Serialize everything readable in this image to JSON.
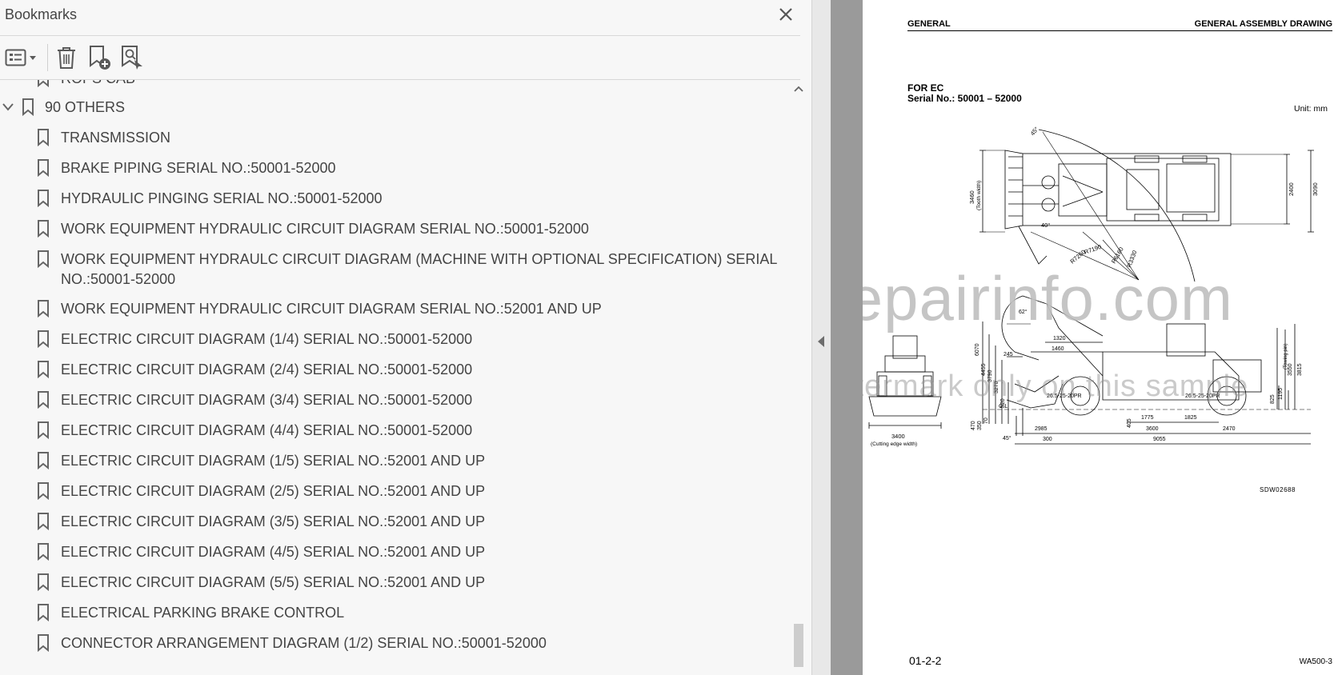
{
  "panel": {
    "title": "Bookmarks",
    "close_label": "✕",
    "toolbar": {
      "options_icon": "list-options-icon",
      "delete_icon": "trash-icon",
      "add_icon": "add-bookmark-icon",
      "find_icon": "find-bookmark-icon"
    },
    "items": [
      {
        "label": "ROPS CAB",
        "level": 1
      },
      {
        "label": "90 OTHERS",
        "level": 0,
        "expanded": true
      },
      {
        "label": "TRANSMISSION",
        "level": 1
      },
      {
        "label": "BRAKE PIPING SERIAL NO.:50001-52000",
        "level": 1
      },
      {
        "label": "HYDRAULIC PINGING SERIAL NO.:50001-52000",
        "level": 1
      },
      {
        "label": "WORK EQUIPMENT HYDRAULIC CIRCUIT DIAGRAM SERIAL NO.:50001-52000",
        "level": 1
      },
      {
        "label": "WORK EQUIPMENT HYDRAULC CIRCUIT DIAGRAM (MACHINE WITH OPTIONAL SPECIFICATION) SERIAL",
        "label2": "NO.:50001-52000",
        "level": 1
      },
      {
        "label": "WORK EQUIPMENT HYDRAULIC CIRCUIT DIAGRAM SERIAL NO.:52001 AND UP",
        "level": 1
      },
      {
        "label": "ELECTRIC CIRCUIT DIAGRAM (1/4) SERIAL NO.:50001-52000",
        "level": 1
      },
      {
        "label": "ELECTRIC CIRCUIT DIAGRAM (2/4) SERIAL NO.:50001-52000",
        "level": 1
      },
      {
        "label": "ELECTRIC CIRCUIT DIAGRAM (3/4) SERIAL NO.:50001-52000",
        "level": 1
      },
      {
        "label": "ELECTRIC CIRCUIT DIAGRAM (4/4) SERIAL NO.:50001-52000",
        "level": 1
      },
      {
        "label": "ELECTRIC CIRCUIT DIAGRAM (1/5) SERIAL NO.:52001 AND UP",
        "level": 1
      },
      {
        "label": "ELECTRIC CIRCUIT DIAGRAM (2/5) SERIAL NO.:52001 AND UP",
        "level": 1
      },
      {
        "label": "ELECTRIC CIRCUIT DIAGRAM (3/5) SERIAL NO.:52001 AND UP",
        "level": 1
      },
      {
        "label": "ELECTRIC CIRCUIT DIAGRAM (4/5) SERIAL NO.:52001 AND UP",
        "level": 1
      },
      {
        "label": "ELECTRIC CIRCUIT DIAGRAM (5/5) SERIAL NO.:52001 AND UP",
        "level": 1
      },
      {
        "label": "ELECTRICAL PARKING BRAKE CONTROL",
        "level": 1
      },
      {
        "label": "CONNECTOR ARRANGEMENT DIAGRAM (1/2) SERIAL NO.:50001-52000",
        "level": 1
      }
    ]
  },
  "document": {
    "header_left": "GENERAL",
    "header_right": "GENERAL ASSEMBLY DRAWING",
    "for_line1": "FOR EC",
    "for_line2": "Serial No.: 50001 – 52000",
    "unit": "Unit: mm",
    "drawing_code": "SDW02688",
    "page_number": "01-2-2",
    "model": "WA500-3",
    "watermark_main": "eRepairinfo.com",
    "watermark_sub": "watermark only on this sample",
    "dimensions": {
      "top_a": "3460",
      "top_b": "(Tooth width)",
      "top_c": "2400",
      "top_d": "3090",
      "r1": "R7190",
      "r2": "R7260",
      "r3": "R6160",
      "r4": "R3330",
      "ang_top": "45°",
      "ang_mid": "40°",
      "front_w": "3400",
      "front_w_label": "(Cutting edge width)",
      "gl": "G.L",
      "h1": "6070",
      "h2": "4455",
      "h3": "3790",
      "h4": "3270",
      "h5": "520",
      "h6": "470",
      "h7": "350",
      "h8": "70",
      "h9": "245",
      "h10": "1320",
      "h11": "1460",
      "h12": "405",
      "w1": "2985",
      "w2": "1775",
      "w3": "1825",
      "w4": "3600",
      "w5": "2470",
      "w6": "9055",
      "w7": "300",
      "tire1": "26.5-25-20PR",
      "tire2": "26.5-25-20PR",
      "rh1": "3815",
      "rh2": "3550",
      "rh3": "1195",
      "rh4": "825",
      "rh5": "(Towing pin)",
      "ang_bot1": "45°",
      "ang_bot2": "62°"
    }
  }
}
